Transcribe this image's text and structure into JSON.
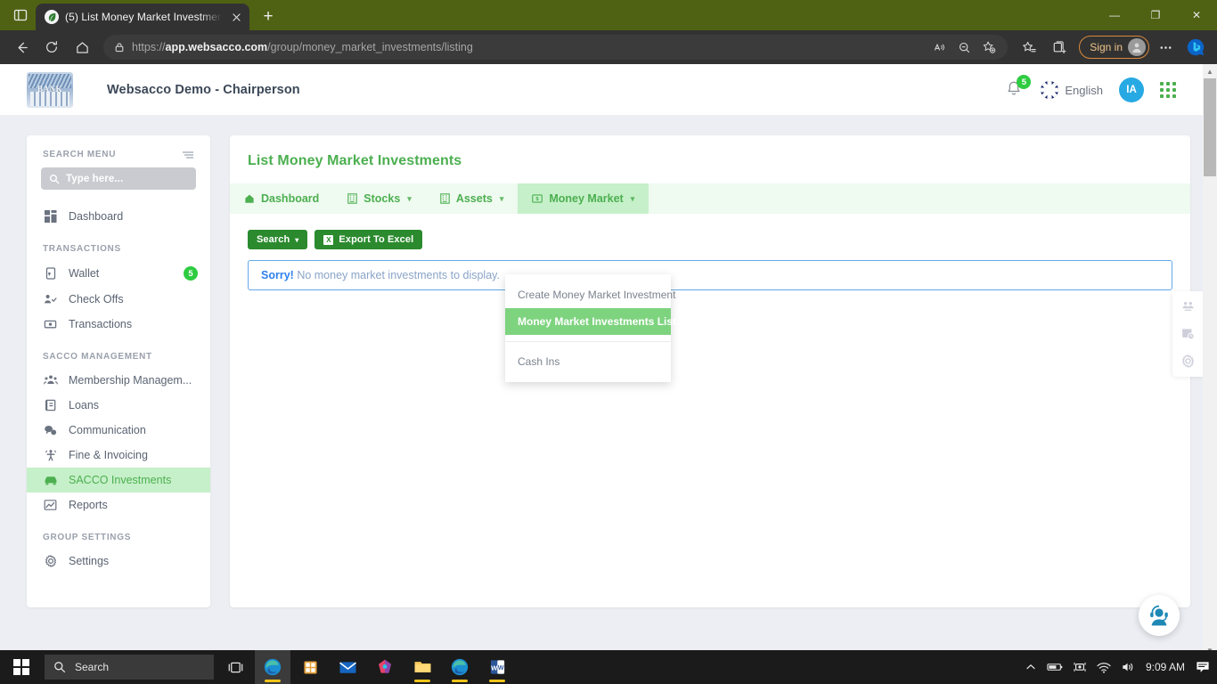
{
  "browser": {
    "tab": {
      "title": "(5) List Money Market Investmen",
      "favicon_icon": "leaf-favicon",
      "close_icon": "close-icon"
    },
    "new_tab_label": "+",
    "sidebar_toggle_icon": "tab-sidebar-icon",
    "nav": {
      "back_icon": "back-arrow-icon",
      "refresh_icon": "refresh-icon",
      "home_icon": "home-icon"
    },
    "address": {
      "lock_icon": "lock-icon",
      "url_prefix": "https://",
      "url_domain": "app.websacco.com",
      "url_path": "/group/money_market_investments/listing",
      "read_aloud_icon": "read-aloud-icon",
      "zoom_icon": "zoom-out-icon",
      "add_favorite_icon": "add-favorite-icon"
    },
    "actions": {
      "favorites_icon": "favorites-list-icon",
      "collections_icon": "collections-icon",
      "sign_in_label": "Sign in",
      "profile_icon": "profile-avatar-icon",
      "settings_icon": "more-options-icon",
      "copilot_icon": "bing-copilot-icon"
    },
    "window_controls": {
      "minimize": "—",
      "maximize": "❐",
      "close": "✕"
    }
  },
  "app_header": {
    "logo_text": "BANK",
    "title": "Websacco Demo - Chairperson",
    "notifications": {
      "icon": "bell-icon",
      "count": "5"
    },
    "language": {
      "flag_icon": "uk-flag-icon",
      "label": "English"
    },
    "user_initials": "IA",
    "apps_grid_icon": "apps-grid-icon"
  },
  "sidebar": {
    "search_menu_label": "SEARCH MENU",
    "collapse_icon": "menu-collapse-icon",
    "search_placeholder": "Type here...",
    "search_icon": "search-icon",
    "top_items": [
      {
        "label": "Dashboard",
        "icon": "dashboard-icon",
        "badge": "",
        "active": false
      }
    ],
    "sections": [
      {
        "title": "TRANSACTIONS",
        "items": [
          {
            "label": "Wallet",
            "icon": "wallet-icon",
            "badge": "5",
            "active": false
          },
          {
            "label": "Check Offs",
            "icon": "check-offs-icon",
            "badge": "",
            "active": false
          },
          {
            "label": "Transactions",
            "icon": "transactions-icon",
            "badge": "",
            "active": false
          }
        ]
      },
      {
        "title": "SACCO MANAGEMENT",
        "items": [
          {
            "label": "Membership Managem...",
            "icon": "membership-icon",
            "badge": "",
            "active": false
          },
          {
            "label": "Loans",
            "icon": "loans-icon",
            "badge": "",
            "active": false
          },
          {
            "label": "Communication",
            "icon": "communication-icon",
            "badge": "",
            "active": false
          },
          {
            "label": "Fine & Invoicing",
            "icon": "fine-invoicing-icon",
            "badge": "",
            "active": false
          },
          {
            "label": "SACCO Investments",
            "icon": "sacco-investments-icon",
            "badge": "",
            "active": true
          },
          {
            "label": "Reports",
            "icon": "reports-icon",
            "badge": "",
            "active": false
          }
        ]
      },
      {
        "title": "GROUP SETTINGS",
        "items": [
          {
            "label": "Settings",
            "icon": "settings-gear-icon",
            "badge": "",
            "active": false
          }
        ]
      }
    ]
  },
  "main": {
    "page_title": "List Money Market Investments",
    "tabs": [
      {
        "label": "Dashboard",
        "icon": "home-icon",
        "caret": false,
        "active": false
      },
      {
        "label": "Stocks",
        "icon": "building-icon",
        "caret": true,
        "active": false
      },
      {
        "label": "Assets",
        "icon": "building-icon",
        "caret": true,
        "active": false
      },
      {
        "label": "Money Market",
        "icon": "money-icon",
        "caret": true,
        "active": true
      }
    ],
    "buttons": {
      "search_label": "Search",
      "search_caret_icon": "chevron-down-icon",
      "export_label": "Export To Excel",
      "export_icon": "excel-icon"
    },
    "alert": {
      "strong": "Sorry!",
      "text": "No money market investments to display."
    },
    "dropdown": {
      "items": [
        {
          "label": "Create Money Market Investment",
          "active": false,
          "separator_after": false
        },
        {
          "label": "Money Market Investments List",
          "active": true,
          "separator_after": true
        },
        {
          "label": "Cash Ins",
          "active": false,
          "separator_after": false
        }
      ]
    }
  },
  "right_rail": {
    "items": [
      {
        "icon": "users-rail-icon"
      },
      {
        "icon": "calendar-clock-rail-icon"
      },
      {
        "icon": "settings-gear-rail-icon"
      }
    ]
  },
  "chat_widget": {
    "icon": "support-headset-icon"
  },
  "taskbar": {
    "start_icon": "windows-start-icon",
    "search_placeholder": "Search",
    "search_icon": "search-icon",
    "task_view_icon": "task-view-icon",
    "apps": [
      {
        "icon": "edge-browser-icon",
        "running": true,
        "active": true
      },
      {
        "icon": "microsoft-store-icon",
        "running": false,
        "active": false
      },
      {
        "icon": "mail-icon",
        "running": false,
        "active": false
      },
      {
        "icon": "paint-3d-icon",
        "running": false,
        "active": false
      },
      {
        "icon": "file-explorer-icon",
        "running": true,
        "active": false
      },
      {
        "icon": "edge-browser-icon",
        "running": true,
        "active": false
      },
      {
        "icon": "word-icon",
        "running": true,
        "active": false
      }
    ],
    "tray": {
      "chevron_icon": "show-hidden-icons",
      "battery_icon": "battery-icon",
      "camera_icon": "camera-privacy-icon",
      "wifi_icon": "wifi-icon",
      "volume_icon": "volume-icon",
      "clock": "9:09 AM",
      "action_center_icon": "action-center-icon"
    }
  }
}
